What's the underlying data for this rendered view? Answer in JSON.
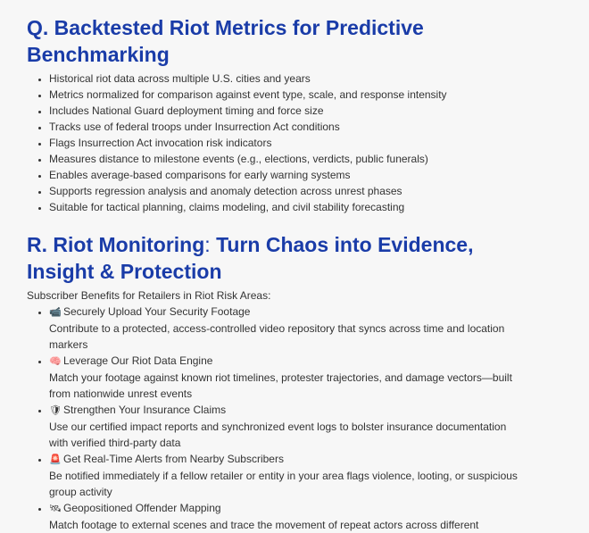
{
  "section_q": {
    "heading": "Q. Backtested Riot Metrics for Predictive Benchmarking",
    "bullets": [
      "Historical riot data across multiple U.S. cities and years",
      "Metrics normalized for comparison against event type, scale, and response intensity",
      "Includes National Guard deployment timing and force size",
      "Tracks use of federal troops under Insurrection Act conditions",
      "Flags Insurrection Act invocation risk indicators",
      "Measures distance to milestone events (e.g., elections, verdicts, public funerals)",
      "Enables average-based comparisons for early warning systems",
      "Supports regression analysis and anomaly detection across unrest phases",
      "Suitable for tactical planning, claims modeling, and civil stability forecasting"
    ]
  },
  "section_r": {
    "heading_bold": "R. Riot Monitoring",
    "heading_plain": ": ",
    "heading_bold2": "Turn Chaos into Evidence, Insight & Protection",
    "intro": "Subscriber Benefits for Retailers in Riot Risk Areas:",
    "benefits": [
      {
        "icon": "📹",
        "icon_name": "video-camera-icon",
        "title": "Securely Upload Your Security Footage",
        "desc": "Contribute to a protected, access-controlled video repository that syncs across time and location markers"
      },
      {
        "icon": "🧠",
        "icon_name": "brain-icon",
        "title": "Leverage Our Riot Data Engine",
        "desc": "Match your footage against known riot timelines, protester trajectories, and damage vectors—built from nationwide unrest events"
      },
      {
        "icon": "🛡",
        "icon_name": "shield-icon",
        "title": "Strengthen Your Insurance Claims",
        "desc": "Use our certified impact reports and synchronized event logs to bolster insurance documentation with verified third-party data"
      },
      {
        "icon": "🚨",
        "icon_name": "alarm-light-icon",
        "title": "Get Real-Time Alerts from Nearby Subscribers",
        "desc": "Be notified immediately if a fellow retailer or entity in your area flags violence, looting, or suspicious group activity"
      },
      {
        "icon": "🛰",
        "icon_name": "satellite-icon",
        "title": "Geopositioned Offender Mapping",
        "desc": "Match footage to external scenes and trace the movement of repeat actors across different"
      }
    ]
  }
}
